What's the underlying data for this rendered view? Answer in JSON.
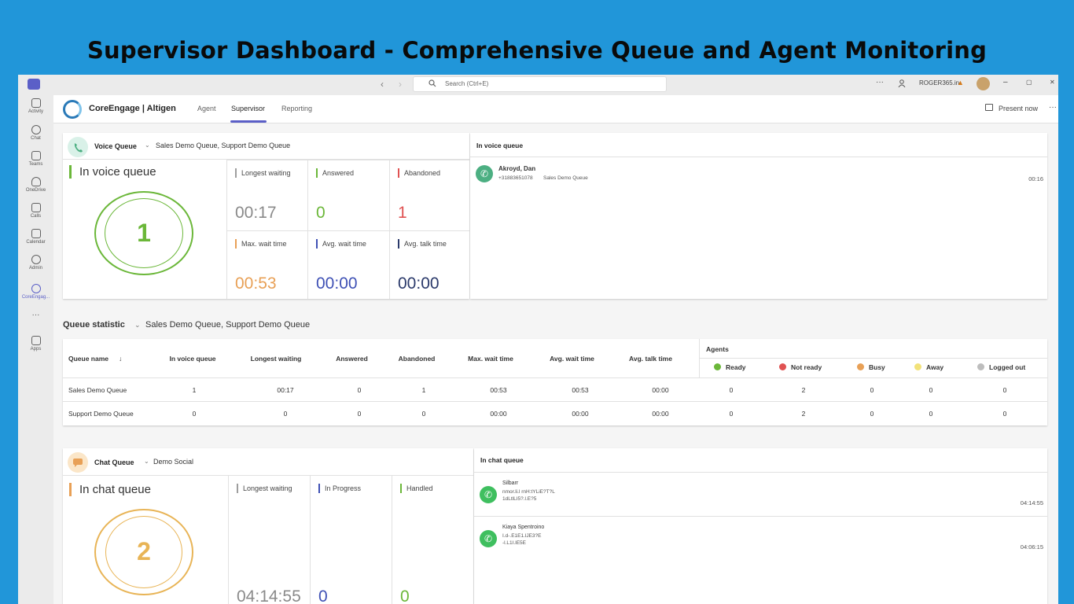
{
  "slide_title": "Supervisor Dashboard - Comprehensive Queue and Agent Monitoring",
  "topbar": {
    "search_placeholder": "Search (Ctrl+E)",
    "more": "···",
    "account": "ROGER365.in",
    "window_controls": [
      "–",
      "▢",
      "✕"
    ]
  },
  "rail": [
    {
      "label": "Activity",
      "icon": "bell-icon"
    },
    {
      "label": "Chat",
      "icon": "chat-icon"
    },
    {
      "label": "Teams",
      "icon": "teams-icon"
    },
    {
      "label": "OneDrive",
      "icon": "cloud-icon"
    },
    {
      "label": "Calls",
      "icon": "phone-icon"
    },
    {
      "label": "Calendar",
      "icon": "calendar-icon"
    },
    {
      "label": "Admin",
      "icon": "admin-icon"
    },
    {
      "label": "CoreEngag...",
      "icon": "coreengage-icon"
    },
    {
      "label": "···",
      "icon": "more-icon"
    },
    {
      "label": "Apps",
      "icon": "apps-icon"
    }
  ],
  "app": {
    "name": "CoreEngage | Altigen",
    "tabs": [
      "Agent",
      "Supervisor",
      "Reporting"
    ],
    "active_tab": "Supervisor",
    "present_now": "Present now",
    "more": "···"
  },
  "voice": {
    "title": "Voice Queue",
    "selected": "Sales Demo Queue, Support Demo Queue",
    "big_label": "In voice queue",
    "big_value": "1",
    "stats": [
      {
        "label": "Longest waiting",
        "value": "00:17",
        "color": "#9e9e9e"
      },
      {
        "label": "Answered",
        "value": "0",
        "color": "#6bb739"
      },
      {
        "label": "Abandoned",
        "value": "1",
        "color": "#e05252"
      },
      {
        "label": "Max. wait time",
        "value": "00:53",
        "color": "#e8a056"
      },
      {
        "label": "Avg. wait time",
        "value": "00:00",
        "color": "#3f51b5"
      },
      {
        "label": "Avg. talk time",
        "value": "00:00",
        "color": "#2b3a6b"
      }
    ],
    "panel_title": "In voice queue",
    "calls": [
      {
        "name": "Akroyd, Dan",
        "number": "+31883651078",
        "queue": "Sales Demo Queue",
        "time": "00:16"
      }
    ]
  },
  "queue_statistic": {
    "title": "Queue statistic",
    "selected": "Sales Demo Queue, Support Demo Queue",
    "columns": [
      "Queue name",
      "In voice queue",
      "Longest waiting",
      "Answered",
      "Abandoned",
      "Max. wait time",
      "Avg. wait time",
      "Avg. talk time"
    ],
    "agents_title": "Agents",
    "agent_states": [
      {
        "label": "Ready",
        "color": "#6bb739"
      },
      {
        "label": "Not ready",
        "color": "#e05252"
      },
      {
        "label": "Busy",
        "color": "#e8a056"
      },
      {
        "label": "Away",
        "color": "#f2e27a"
      },
      {
        "label": "Logged out",
        "color": "#bdbdbd"
      }
    ],
    "rows": [
      [
        "Sales Demo Queue",
        "1",
        "00:17",
        "0",
        "1",
        "00:53",
        "00:53",
        "00:00",
        "0",
        "2",
        "0",
        "0",
        "0"
      ],
      [
        "Support Demo Queue",
        "0",
        "0",
        "0",
        "0",
        "00:00",
        "00:00",
        "00:00",
        "0",
        "2",
        "0",
        "0",
        "0"
      ]
    ]
  },
  "chat": {
    "title": "Chat Queue",
    "selected": "Demo Social",
    "big_label": "In chat queue",
    "big_value": "2",
    "stats": [
      {
        "label": "Longest waiting",
        "value": "04:14:55",
        "color": "#9e9e9e"
      },
      {
        "label": "In Progress",
        "value": "0",
        "color": "#3f51b5"
      },
      {
        "label": "Handled",
        "value": "0",
        "color": "#6bb739"
      }
    ],
    "panel_title": "In chat queue",
    "chats": [
      {
        "name": "Silbarr",
        "line1": "nmor.li.l rnH:tYLiE?T?L",
        "line2": "1dLtlLI5?.l.E?5",
        "time": "04:14:55"
      },
      {
        "name": "Kiaya Spentroino",
        "line1": "I.d-.E1E1.lJE3?E",
        "line2": "-l.L1I.lE5E",
        "time": "04:06:15"
      }
    ]
  }
}
